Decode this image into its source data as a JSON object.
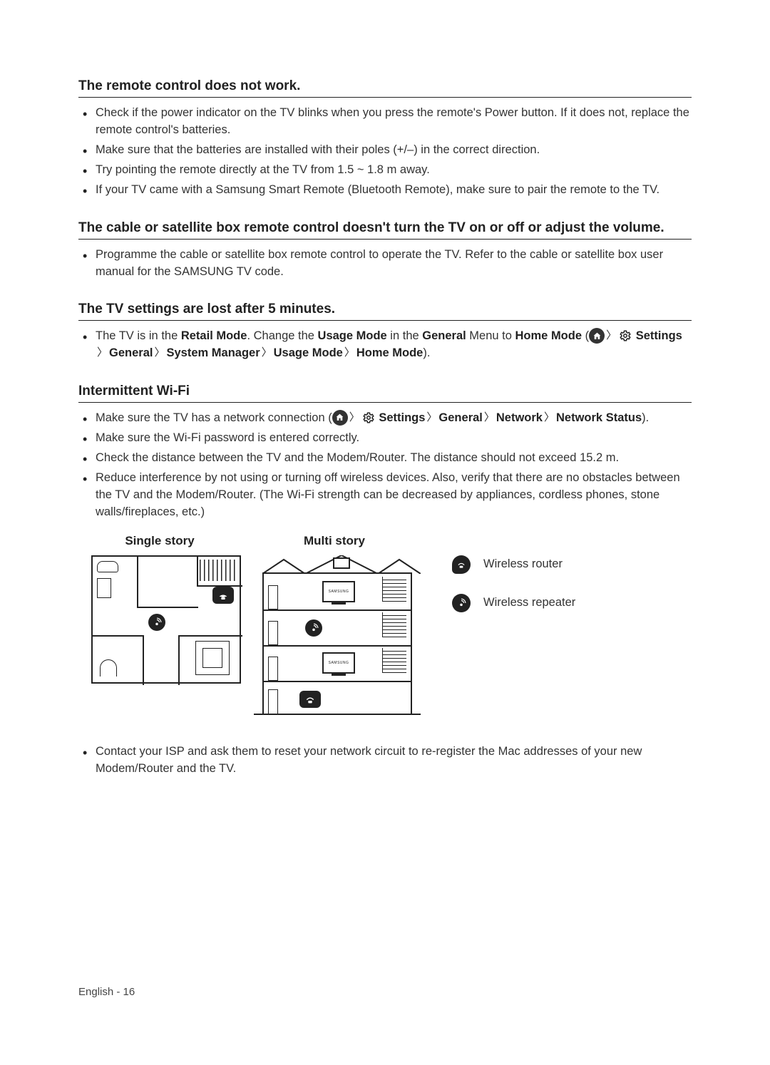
{
  "footer": "English - 16",
  "sections": [
    {
      "heading": "The remote control does not work.",
      "bullets": [
        "Check if the power indicator on the TV blinks when you press the remote's Power button. If it does not, replace the remote control's batteries.",
        "Make sure that the batteries are installed with their poles (+/–) in the correct direction.",
        "Try pointing the remote directly at the TV from 1.5 ~ 1.8 m away.",
        "If your TV came with a Samsung Smart Remote (Bluetooth Remote), make sure to pair the remote to the TV."
      ]
    },
    {
      "heading": "The cable or satellite box remote control doesn't turn the TV on or off or adjust the volume.",
      "bullets": [
        "Programme the cable or satellite box remote control to operate the TV. Refer to the cable or satellite box user manual for the SAMSUNG TV code."
      ]
    },
    {
      "heading": "The TV settings are lost after 5 minutes."
    },
    {
      "heading": "Intermittent Wi-Fi"
    }
  ],
  "retail": {
    "pre": "The TV is in the ",
    "retail_mode": "Retail Mode",
    "mid1": ". Change the ",
    "usage_mode": "Usage Mode",
    "mid2": " in the ",
    "general": "General",
    "mid3": " Menu to ",
    "home_mode": "Home Mode",
    "open": " (",
    "settings": "Settings",
    "system_manager": "System Manager",
    "close": ")."
  },
  "wifi": {
    "line1_pre": "Make sure the TV has a network connection (",
    "settings": "Settings",
    "general": "General",
    "network": "Network",
    "network_status": "Network Status",
    "line1_close": ").",
    "line2": "Make sure the Wi-Fi password is entered correctly.",
    "line3": "Check the distance between the TV and the Modem/Router. The distance should not exceed 15.2 m.",
    "line4": "Reduce interference by not using or turning off wireless devices. Also, verify that there are no obstacles between the TV and the Modem/Router. (The Wi-Fi strength can be decreased by appliances, cordless phones, stone walls/fireplaces, etc.)",
    "line5": "Contact your ISP and ask them to reset your network circuit to re-register the Mac addresses of your new Modem/Router and the TV."
  },
  "diagrams": {
    "single_title": "Single story",
    "multi_title": "Multi story",
    "legend_router": "Wireless router",
    "legend_repeater": "Wireless repeater",
    "tv_label": "SAMSUNG"
  }
}
